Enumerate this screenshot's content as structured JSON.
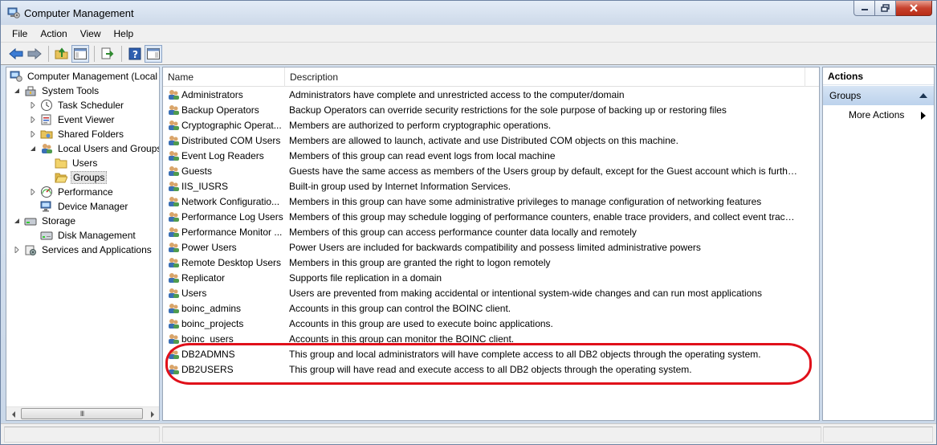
{
  "window": {
    "title": "Computer Management",
    "accent": "#cdd9e9",
    "close_color": "#c7422e"
  },
  "menu": [
    "File",
    "Action",
    "View",
    "Help"
  ],
  "toolbar": {
    "buttons": [
      "back-arrow-icon",
      "forward-arrow-icon",
      "up-folder-icon",
      "show-hide-console-tree-icon",
      "export-list-icon",
      "help-icon",
      "show-hide-action-pane-icon"
    ]
  },
  "tree": {
    "items": [
      {
        "label": "Computer Management (Local",
        "level": 0,
        "expander": "",
        "icon": "computer-management-icon"
      },
      {
        "label": "System Tools",
        "level": 1,
        "expander": "expanded",
        "icon": "tools-icon"
      },
      {
        "label": "Task Scheduler",
        "level": 2,
        "expander": "collapsed",
        "icon": "clock-icon"
      },
      {
        "label": "Event Viewer",
        "level": 2,
        "expander": "collapsed",
        "icon": "event-viewer-icon"
      },
      {
        "label": "Shared Folders",
        "level": 2,
        "expander": "collapsed",
        "icon": "shared-folder-icon"
      },
      {
        "label": "Local Users and Groups",
        "level": 2,
        "expander": "expanded",
        "icon": "users-icon"
      },
      {
        "label": "Users",
        "level": 3,
        "expander": "",
        "icon": "folder-icon"
      },
      {
        "label": "Groups",
        "level": 3,
        "expander": "",
        "icon": "folder-open-icon",
        "selected": true
      },
      {
        "label": "Performance",
        "level": 2,
        "expander": "collapsed",
        "icon": "performance-icon"
      },
      {
        "label": "Device Manager",
        "level": 2,
        "expander": "",
        "icon": "device-manager-icon"
      },
      {
        "label": "Storage",
        "level": 1,
        "expander": "expanded",
        "icon": "storage-icon"
      },
      {
        "label": "Disk Management",
        "level": 2,
        "expander": "",
        "icon": "disk-icon"
      },
      {
        "label": "Services and Applications",
        "level": 1,
        "expander": "collapsed",
        "icon": "services-icon"
      }
    ],
    "scroll_grip": "III"
  },
  "list": {
    "columns": {
      "name": "Name",
      "description": "Description"
    },
    "rows": [
      {
        "name": "Administrators",
        "description": "Administrators have complete and unrestricted access to the computer/domain"
      },
      {
        "name": "Backup Operators",
        "description": "Backup Operators can override security restrictions for the sole purpose of backing up or restoring files"
      },
      {
        "name": "Cryptographic Operat...",
        "description": "Members are authorized to perform cryptographic operations."
      },
      {
        "name": "Distributed COM Users",
        "description": "Members are allowed to launch, activate and use Distributed COM objects on this machine."
      },
      {
        "name": "Event Log Readers",
        "description": "Members of this group can read event logs from local machine"
      },
      {
        "name": "Guests",
        "description": "Guests have the same access as members of the Users group by default, except for the Guest account which is further r..."
      },
      {
        "name": "IIS_IUSRS",
        "description": "Built-in group used by Internet Information Services."
      },
      {
        "name": "Network Configuratio...",
        "description": "Members in this group can have some administrative privileges to manage configuration of networking features"
      },
      {
        "name": "Performance Log Users",
        "description": "Members of this group may schedule logging of performance counters, enable trace providers, and collect event traces..."
      },
      {
        "name": "Performance Monitor ...",
        "description": "Members of this group can access performance counter data locally and remotely"
      },
      {
        "name": "Power Users",
        "description": "Power Users are included for backwards compatibility and possess limited administrative powers"
      },
      {
        "name": "Remote Desktop Users",
        "description": "Members in this group are granted the right to logon remotely"
      },
      {
        "name": "Replicator",
        "description": "Supports file replication in a domain"
      },
      {
        "name": "Users",
        "description": "Users are prevented from making accidental or intentional system-wide changes and can run most applications"
      },
      {
        "name": "boinc_admins",
        "description": "Accounts in this group can control the BOINC client."
      },
      {
        "name": "boinc_projects",
        "description": "Accounts in this group are used to execute boinc applications."
      },
      {
        "name": "boinc_users",
        "description": "Accounts in this group can monitor the BOINC client."
      },
      {
        "name": "DB2ADMNS",
        "description": "This group and local administrators will have complete access to all DB2 objects through the operating system."
      },
      {
        "name": "DB2USERS",
        "description": "This group will have read and execute access to all DB2 objects through the operating system."
      }
    ],
    "highlight_color": "#e0101a"
  },
  "actions": {
    "title": "Actions",
    "section": "Groups",
    "more": "More Actions"
  }
}
